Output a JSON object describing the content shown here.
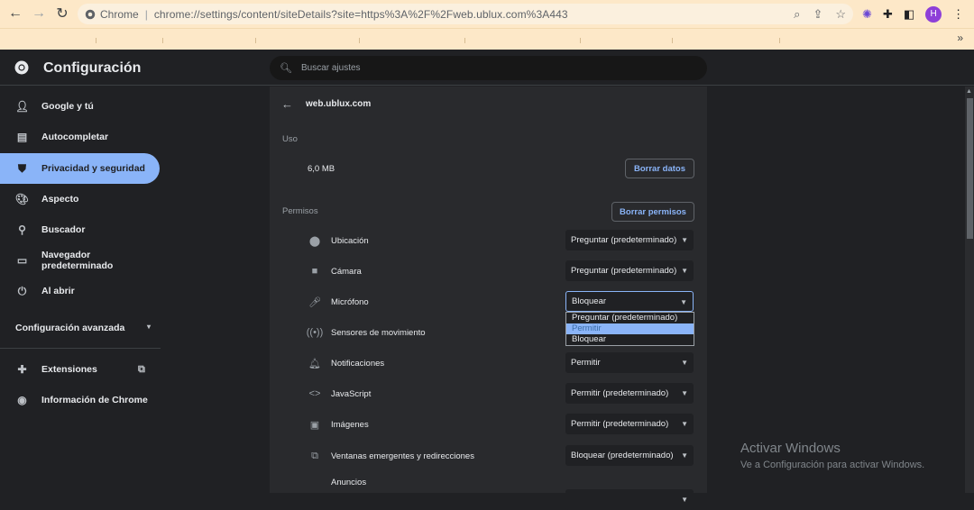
{
  "browser": {
    "site_chip": "Chrome",
    "url": "chrome://settings/content/siteDetails?site=https%3A%2F%2Fweb.ublux.com%3A443",
    "profile_initial": "H",
    "bookmarks_more": "»"
  },
  "header": {
    "title": "Configuración",
    "search_placeholder": "Buscar ajustes"
  },
  "sidebar": {
    "items": [
      {
        "label": "Google y tú",
        "icon": "person-icon"
      },
      {
        "label": "Autocompletar",
        "icon": "clipboard-icon"
      },
      {
        "label": "Privacidad y seguridad",
        "icon": "shield-icon"
      },
      {
        "label": "Aspecto",
        "icon": "palette-icon"
      },
      {
        "label": "Buscador",
        "icon": "search-icon"
      },
      {
        "label": "Navegador predeterminado",
        "icon": "browser-icon"
      },
      {
        "label": "Al abrir",
        "icon": "power-icon"
      }
    ],
    "advanced": "Configuración avanzada",
    "extensions": "Extensiones",
    "about": "Información de Chrome"
  },
  "main": {
    "site_title": "web.ublux.com",
    "usage_label": "Uso",
    "usage_value": "6,0 MB",
    "clear_data": "Borrar datos",
    "permissions_label": "Permisos",
    "reset_permissions": "Borrar permisos",
    "permissions": [
      {
        "label": "Ubicación",
        "value": "Preguntar (predeterminado)"
      },
      {
        "label": "Cámara",
        "value": "Preguntar (predeterminado)"
      },
      {
        "label": "Micrófono",
        "value": "Bloquear"
      },
      {
        "label": "Sensores de movimiento",
        "value": ""
      },
      {
        "label": "Notificaciones",
        "value": "Permitir"
      },
      {
        "label": "JavaScript",
        "value": "Permitir (predeterminado)"
      },
      {
        "label": "Imágenes",
        "value": "Permitir (predeterminado)"
      },
      {
        "label": "Ventanas emergentes y redirecciones",
        "value": "Bloquear (predeterminado)"
      },
      {
        "label": "Anuncios",
        "value": ""
      }
    ],
    "dropdown_options": [
      "Preguntar (predeterminado)",
      "Permitir",
      "Bloquear"
    ]
  },
  "watermark": {
    "title": "Activar Windows",
    "subtitle": "Ve a Configuración para activar Windows."
  },
  "colors": {
    "accent": "#8ab4f8",
    "background": "#202124",
    "card": "#292a2d",
    "toolbar": "#fde8c8"
  }
}
